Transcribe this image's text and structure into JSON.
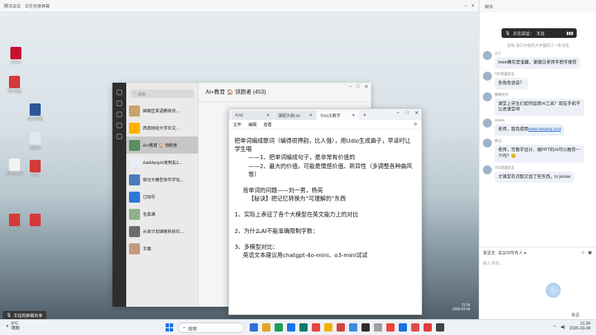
{
  "meeting_bar": {
    "title": "腾讯会议",
    "status": "正在共享屏幕"
  },
  "desktop_icons": [
    {
      "label": "Zotero",
      "color": "#c8102e"
    },
    {
      "label": "PDF文档",
      "color": "#d43a3a"
    },
    {
      "label": "Word文档",
      "color": "#2b579a"
    },
    {
      "label": "回收站",
      "color": "#dfe8f0"
    },
    {
      "label": "新建文件夹",
      "color": "#f2f2f2"
    },
    {
      "label": "PDF",
      "color": "#d43a3a"
    },
    {
      "label": "PDF",
      "color": "#d43a3a"
    },
    {
      "label": "PDF",
      "color": "#d43a3a"
    }
  ],
  "wechat": {
    "search_placeholder": "搜索",
    "group_title": "AI+教育 🏠 领跑者 (453)",
    "chat_items": [
      {
        "title": "国家区英语教研员...",
        "preview": "",
        "color": "#c8a36a"
      },
      {
        "title": "西南财经大学社文...",
        "preview": "",
        "color": "#ffb300"
      },
      {
        "title": "AI+教育 🏠 领跑者",
        "preview": "",
        "color": "#5a8f5f"
      },
      {
        "title": "AskManyAI发明友2...",
        "preview": "",
        "color": "#e8eef7"
      },
      {
        "title": "探讨大模型协作学化...",
        "preview": "",
        "color": "#4a7ebb"
      },
      {
        "title": "订阅号",
        "preview": "",
        "color": "#2f78d6"
      },
      {
        "title": "毛翕满",
        "preview": "",
        "color": "#8fb08a"
      },
      {
        "title": "元卓计划酒客科技社...",
        "preview": "",
        "color": "#6b6b6b"
      },
      {
        "title": "王璐",
        "preview": "",
        "color": "#c49a7a"
      }
    ]
  },
  "notepad": {
    "tabs": [
      "4.txt",
      "课程大纲.txt",
      "RACE教学"
    ],
    "menu": [
      "文件",
      "编辑",
      "查看"
    ],
    "lines": [
      {
        "t": "把单词编成歌词（编得很押韵，比人强），用Udio生成曲子，早读时让学生唱",
        "c": ""
      },
      {
        "t": "——1、把单词编成句子，是非常有价值的",
        "c": "in"
      },
      {
        "t": "——2、最大的价值，可能是情感价值、新异性（多调整各种曲风等）",
        "c": "in"
      },
      {
        "t": "",
        "c": "gap"
      },
      {
        "t": "背单词的问题——刘一男，杨亮",
        "c": "in2"
      },
      {
        "t": "【秘诀】把记忆转换为“可理解的”东西",
        "c": "in"
      },
      {
        "t": "",
        "c": "gap"
      },
      {
        "t": "1、实际上表征了各个大模型在英文能力上的对比",
        "c": ""
      },
      {
        "t": "",
        "c": "gap"
      },
      {
        "t": "2、为什么AI不能准确限制字数：",
        "c": ""
      },
      {
        "t": "",
        "c": "gap"
      },
      {
        "t": "3、多模型对比：",
        "c": ""
      },
      {
        "t": "英语文本建议用chatgpt-4o-mini、o3-mini试试",
        "c": "in2"
      }
    ]
  },
  "right_panel": {
    "header": "聊天",
    "speaking_label": "正在讲话：",
    "speaker": "王珏",
    "messages": [
      {
        "type": "sys",
        "text": "张晓-浙江中医药大学撤回了一条消息"
      },
      {
        "type": "msg",
        "name": "马丁",
        "text": "twee确实是宝藏，谢谢白老师手把手推荐",
        "link": ""
      },
      {
        "type": "msg",
        "name": "702调遇叔龙",
        "text": "多角色语音？",
        "link": ""
      },
      {
        "type": "msg",
        "name": "春暖花开",
        "text": "课堂上学生们如何运用AI工具？现在手机不让进课堂呀",
        "link": ""
      },
      {
        "type": "msg",
        "name": "Jessie",
        "text": "老师，我有使用",
        "link": "www.ketang.cool"
      },
      {
        "type": "msg",
        "name": "微尘",
        "text": "老师，写教学设计、做PPT的AI可以推荐一个吗？😊",
        "link": ""
      },
      {
        "type": "msg",
        "name": "702调遇叔龙",
        "text": "才课堂有点酷又加了些东西。to jessie",
        "link": ""
      }
    ],
    "send_label": "发送至",
    "send_target": "会议中所有人",
    "input_placeholder": "输入消息...",
    "send_button": "发送"
  },
  "share_badge": "王珏的屏幕共享",
  "taskbar": {
    "weather_temp": "8°C",
    "weather_desc": "晴朗",
    "search": "搜索",
    "time": "21:34",
    "date": "2025-03-09",
    "apps": [
      "#2f6fd6",
      "#e4a321",
      "#1f9d55",
      "#1a73e8",
      "#0f7b6c",
      "#e8453c",
      "#f0b400",
      "#d14242",
      "#3c8dde",
      "#2d2d2d",
      "#a0a0a0",
      "#e8453c",
      "#1d6fe0",
      "#e14b4b",
      "#e23b3b",
      "#444"
    ]
  }
}
